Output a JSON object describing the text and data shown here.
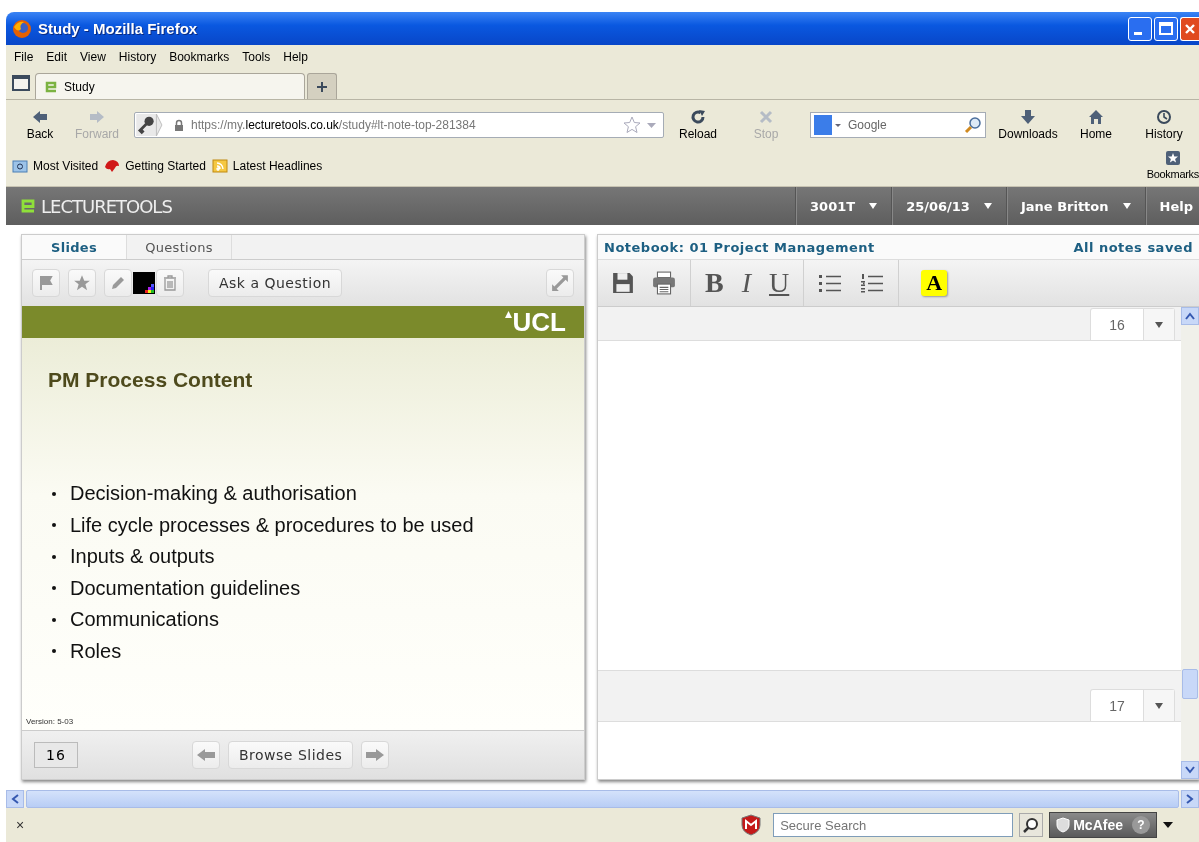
{
  "window": {
    "title": "Study - Mozilla Firefox"
  },
  "menu": [
    "File",
    "Edit",
    "View",
    "History",
    "Bookmarks",
    "Tools",
    "Help"
  ],
  "tabs": [
    {
      "label": "Study",
      "selected": true
    }
  ],
  "nav": [
    {
      "kind": "back",
      "label": "Back",
      "disabled": false
    },
    {
      "kind": "forward",
      "label": "Forward",
      "disabled": true
    }
  ],
  "url": {
    "prefix": "https://my.",
    "domain": "lecturetools.co.uk",
    "path": "/study#lt-note-top-281384"
  },
  "nav2": [
    {
      "kind": "reload",
      "label": "Reload",
      "disabled": false
    },
    {
      "kind": "stop",
      "label": "Stop",
      "disabled": true
    }
  ],
  "search": {
    "placeholder": "Google"
  },
  "tools": [
    {
      "kind": "downloads",
      "label": "Downloads"
    },
    {
      "kind": "home",
      "label": "Home"
    },
    {
      "kind": "history",
      "label": "History"
    }
  ],
  "bookmarks_button": "Bookmarks",
  "bookmarks_bar": [
    {
      "kind": "folder",
      "label": "Most Visited"
    },
    {
      "kind": "starter",
      "label": "Getting Started"
    },
    {
      "kind": "feed",
      "label": "Latest Headlines"
    }
  ],
  "app": {
    "logo": "LECTURETOOLS",
    "menus": [
      "3001T",
      "25/06/13",
      "Jane Britton"
    ],
    "help": "Help"
  },
  "slides_panel": {
    "tabs": [
      {
        "label": "Slides",
        "selected": true
      },
      {
        "label": "Questions",
        "selected": false
      }
    ],
    "ask": "Ask a Question",
    "slide": {
      "brand": "UCL",
      "title": "PM Process Content",
      "bullets": [
        "Decision-making & authorisation",
        "Life cycle processes & procedures to be used",
        "Inputs & outputs",
        "Documentation guidelines",
        "Communications",
        "Roles"
      ],
      "version": "Version: 5-03"
    },
    "page": "16",
    "browse": "Browse Slides"
  },
  "notebook": {
    "title": "Notebook: 01 Project Management",
    "status": "All notes saved",
    "format": [
      {
        "kind": "bold",
        "label": "B"
      },
      {
        "kind": "italic",
        "label": "I"
      },
      {
        "kind": "underline",
        "label": "U"
      }
    ],
    "highlight": "A",
    "pages": [
      "16",
      "17"
    ]
  },
  "status_bar": {
    "close": "×",
    "search_placeholder": "Secure Search",
    "brand": "McAfee",
    "help": "?"
  }
}
